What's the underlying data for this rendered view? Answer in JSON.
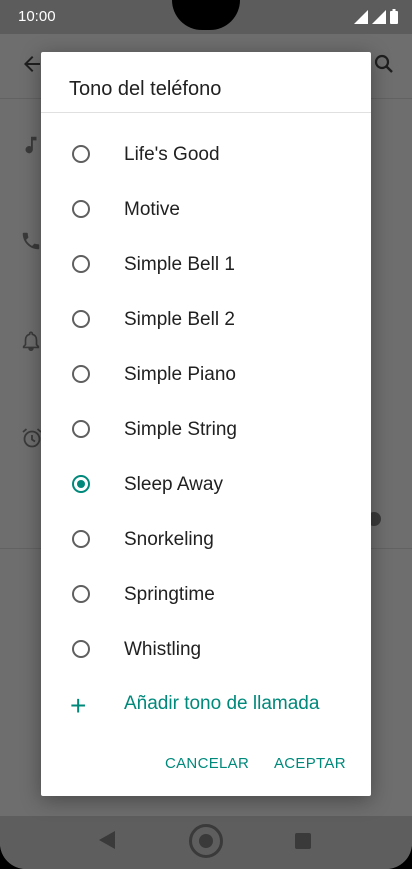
{
  "status_bar": {
    "time": "10:00"
  },
  "dialog": {
    "title": "Tono del teléfono",
    "options": [
      {
        "label": "Life's Good",
        "selected": false
      },
      {
        "label": "Motive",
        "selected": false
      },
      {
        "label": "Simple Bell 1",
        "selected": false
      },
      {
        "label": "Simple Bell 2",
        "selected": false
      },
      {
        "label": "Simple Piano",
        "selected": false
      },
      {
        "label": "Simple String",
        "selected": false
      },
      {
        "label": "Sleep Away",
        "selected": true
      },
      {
        "label": "Snorkeling",
        "selected": false
      },
      {
        "label": "Springtime",
        "selected": false
      },
      {
        "label": "Whistling",
        "selected": false
      }
    ],
    "add_label": "Añadir tono de llamada",
    "cancel_label": "CANCELAR",
    "accept_label": "ACEPTAR"
  },
  "colors": {
    "accent": "#00897b",
    "scrim": "#6e6e6e"
  },
  "icons": [
    "back-arrow-icon",
    "search-icon",
    "music-note-icon",
    "phone-icon",
    "bell-icon",
    "alarm-clock-icon",
    "add-icon"
  ]
}
